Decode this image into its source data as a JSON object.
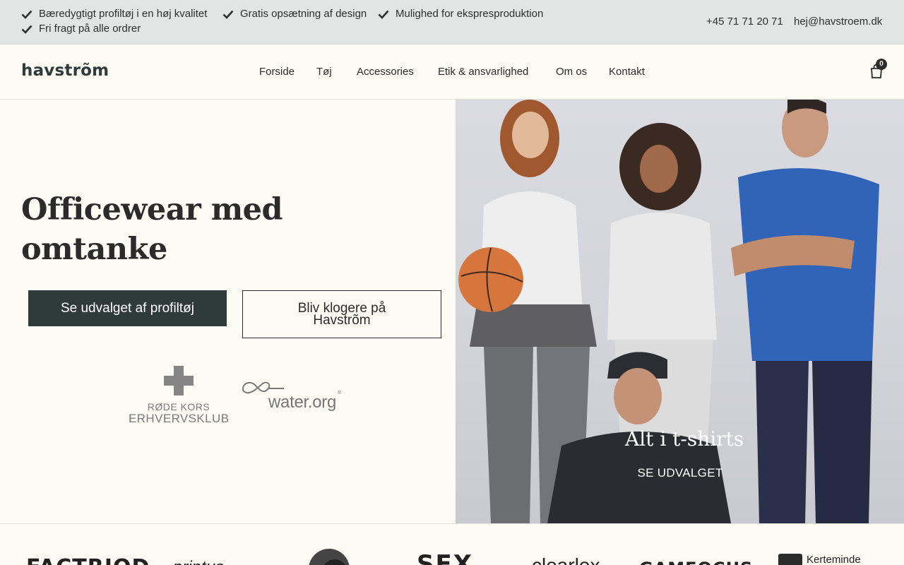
{
  "topbar": {
    "usps": [
      "Bæredygtigt profiltøj i en høj kvalitet",
      "Gratis opsætning af design",
      "Mulighed for ekspresproduktion",
      "Fri fragt på alle ordrer"
    ],
    "phone": "+45 71 71 20 71",
    "email": "hej@havstroem.dk"
  },
  "header": {
    "logo": "havstrõm",
    "nav": [
      "Forside",
      "Tøj",
      "Accessories",
      "Etik & ansvarlighed",
      "Om os",
      "Kontakt"
    ],
    "cart_count": "0"
  },
  "hero": {
    "title": "Officewear med omtanke",
    "primary_button": "Se udvalget af profiltøj",
    "secondary_button": "Bliv klogere på Havstrõm",
    "partner_rk_line1": "RØDE KORS",
    "partner_rk_line2": "ERHVERVSKLUB",
    "partner_water": "water.org",
    "caption": "Alt i t-shirts",
    "caption_cta": "SE UDVALGET"
  },
  "brands": [
    "FACTRIOD",
    "printus",
    "",
    "SEX",
    "clearlex",
    "GAMEOCUS",
    "Kerteminde"
  ],
  "colors": {
    "background": "#fcfcf4",
    "topbar": "#e3e5e5",
    "primary_button": "#2f3b3b"
  }
}
